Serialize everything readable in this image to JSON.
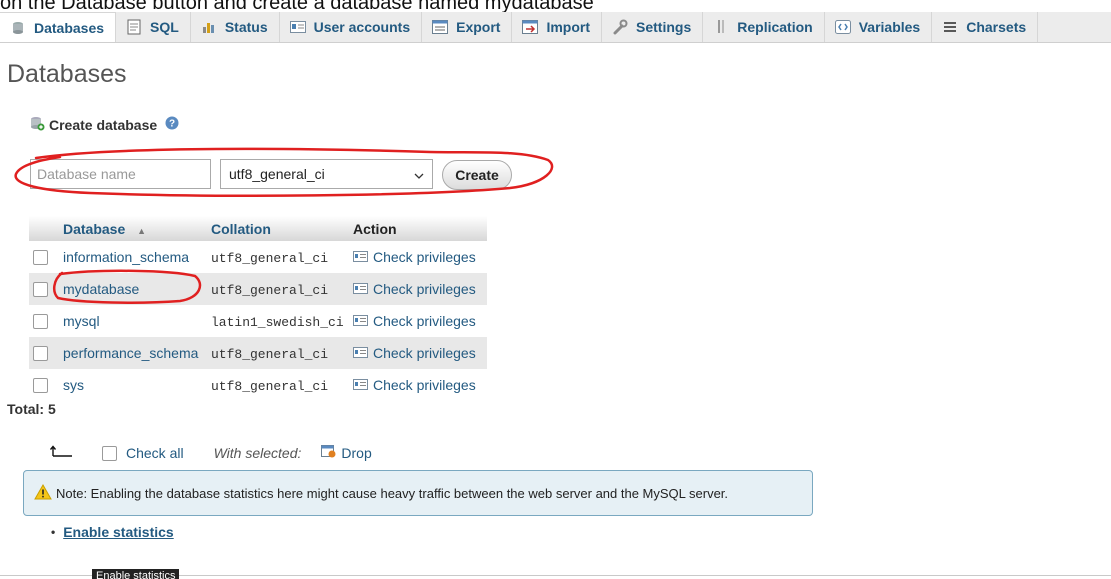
{
  "caption": "on the Database button and create a database named mydatabase",
  "tabs": [
    {
      "label": "Databases",
      "icon": "database-icon",
      "active": true
    },
    {
      "label": "SQL",
      "icon": "sql-icon"
    },
    {
      "label": "Status",
      "icon": "status-icon"
    },
    {
      "label": "User accounts",
      "icon": "user-accounts-icon"
    },
    {
      "label": "Export",
      "icon": "export-icon"
    },
    {
      "label": "Import",
      "icon": "import-icon"
    },
    {
      "label": "Settings",
      "icon": "wrench-icon"
    },
    {
      "label": "Replication",
      "icon": "replication-icon"
    },
    {
      "label": "Variables",
      "icon": "variables-icon"
    },
    {
      "label": "Charsets",
      "icon": "charsets-icon"
    }
  ],
  "page_title": "Databases",
  "create": {
    "heading": "Create database",
    "name_placeholder": "Database name",
    "name_value": "",
    "collation_selected": "utf8_general_ci",
    "button_label": "Create"
  },
  "table": {
    "headers": {
      "database": "Database",
      "collation": "Collation",
      "action": "Action"
    },
    "rows": [
      {
        "name": "information_schema",
        "collation": "utf8_general_ci",
        "action": "Check privileges"
      },
      {
        "name": "mydatabase",
        "collation": "utf8_general_ci",
        "action": "Check privileges"
      },
      {
        "name": "mysql",
        "collation": "latin1_swedish_ci",
        "action": "Check privileges"
      },
      {
        "name": "performance_schema",
        "collation": "utf8_general_ci",
        "action": "Check privileges"
      },
      {
        "name": "sys",
        "collation": "utf8_general_ci",
        "action": "Check privileges"
      }
    ]
  },
  "total_label": "Total: 5",
  "bulk": {
    "check_all": "Check all",
    "with_selected": "With selected:",
    "drop": "Drop"
  },
  "notice": "Note: Enabling the database statistics here might cause heavy traffic between the web server and the MySQL server.",
  "enable_statistics": "Enable statistics",
  "tooltip": "Enable statistics",
  "colors": {
    "link": "#235a81",
    "annotation": "#e02020",
    "notice_bg": "#e6f0f5"
  }
}
